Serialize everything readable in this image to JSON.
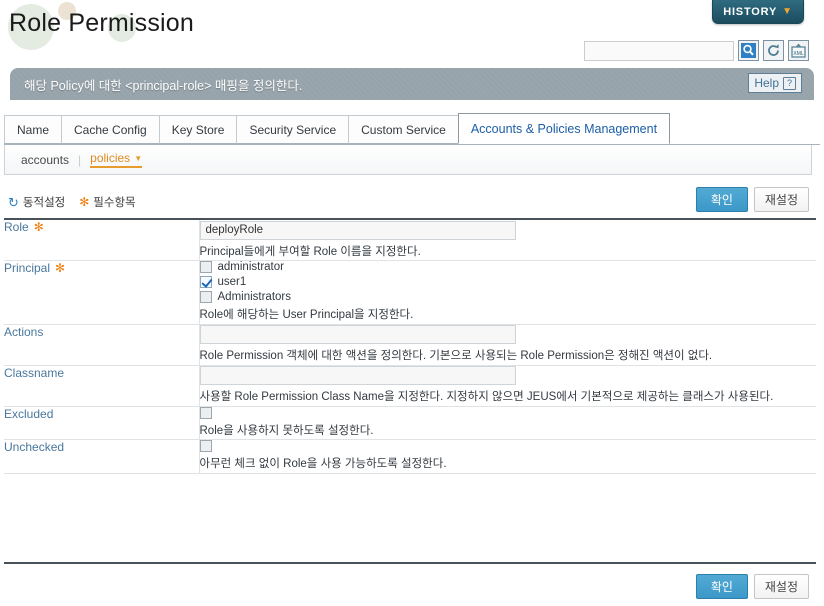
{
  "header": {
    "title": "Role Permission",
    "history_label": "HISTORY",
    "history_caret": "▼",
    "search_value": "",
    "search_placeholder": "",
    "icons": {
      "search": "search-icon",
      "reload": "reload-icon",
      "xml_export": "xml-export-icon"
    }
  },
  "banner": {
    "text": "해당 Policy에 대한 <principal-role> 매핑을 정의한다.",
    "help_label": "Help",
    "help_icon": "?"
  },
  "tabs": [
    {
      "label": "Name",
      "active": false
    },
    {
      "label": "Cache Config",
      "active": false
    },
    {
      "label": "Key Store",
      "active": false
    },
    {
      "label": "Security Service",
      "active": false
    },
    {
      "label": "Custom Service",
      "active": false
    },
    {
      "label": "Accounts & Policies Management",
      "active": true
    }
  ],
  "subnav": {
    "accounts_label": "accounts",
    "separator": "|",
    "policies_label": "policies",
    "caret": "▼"
  },
  "legend": {
    "dynamic_icon": "↻",
    "dynamic_label": "동적설정",
    "required_icon": "✻",
    "required_label": "필수항목"
  },
  "actions": {
    "confirm_label": "확인",
    "reset_label": "재설정"
  },
  "form": {
    "rows": [
      {
        "label": "Role",
        "required": true,
        "type": "text",
        "value": "deployRole",
        "placeholder": "",
        "description": "Principal들에게 부여할 Role 이름을 지정한다."
      },
      {
        "label": "Principal",
        "required": true,
        "type": "checkbox-list",
        "options": [
          {
            "label": "administrator",
            "checked": false
          },
          {
            "label": "user1",
            "checked": true
          },
          {
            "label": "Administrators",
            "checked": false
          }
        ],
        "description": "Role에 해당하는 User Principal을 지정한다."
      },
      {
        "label": "Actions",
        "required": false,
        "type": "text",
        "value": "",
        "placeholder": "",
        "description": "Role Permission 객체에 대한 액션을 정의한다. 기본으로 사용되는 Role Permission은 정해진 액션이 없다."
      },
      {
        "label": "Classname",
        "required": false,
        "type": "text",
        "value": "",
        "placeholder": "",
        "description": "사용할 Role Permission Class Name을 지정한다. 지정하지 않으면 JEUS에서 기본적으로 제공하는 클래스가 사용된다."
      },
      {
        "label": "Excluded",
        "required": false,
        "type": "checkbox",
        "checked": false,
        "description": "Role을 사용하지 못하도록 설정한다."
      },
      {
        "label": "Unchecked",
        "required": false,
        "type": "checkbox",
        "checked": false,
        "description": "아무런 체크 없이 Role을 사용 가능하도록 설정한다."
      }
    ]
  },
  "colors": {
    "accent_blue": "#3b98c8",
    "label_blue": "#49779c",
    "required_orange": "#f07f10",
    "active_tab_blue": "#1c5ea8",
    "banner_gray": "#9aa6ae",
    "history_teal": "#245a6e"
  }
}
